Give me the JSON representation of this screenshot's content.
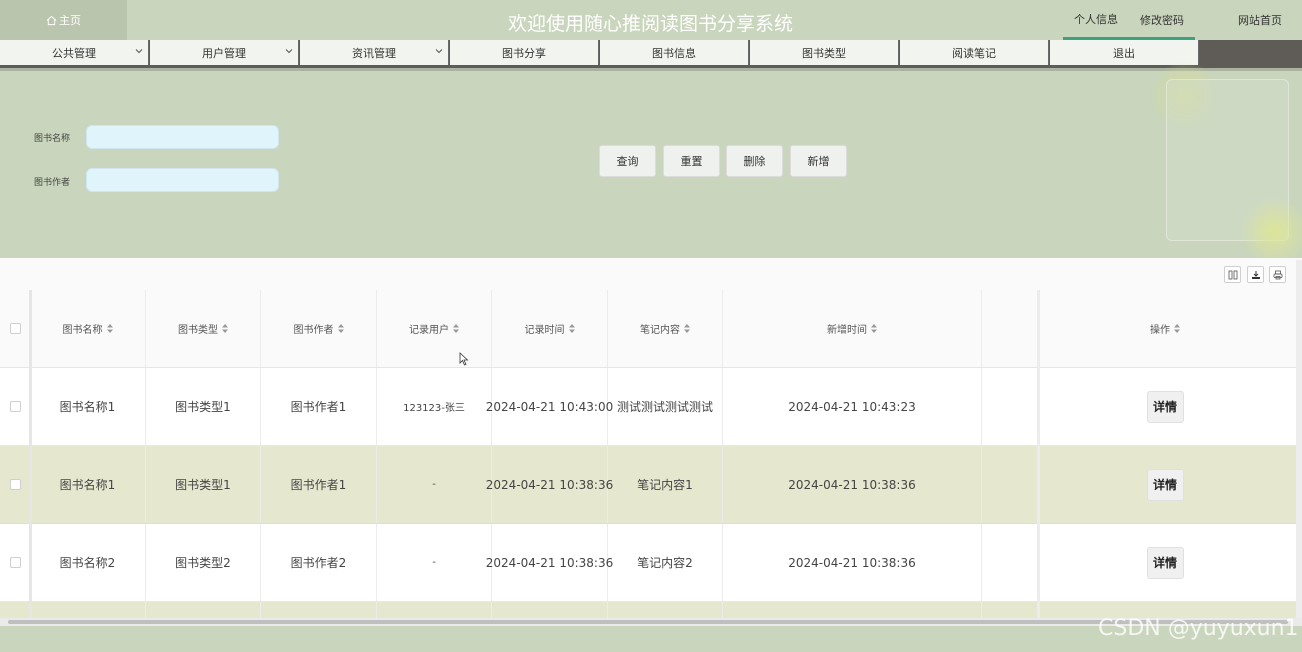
{
  "header": {
    "home": "主页",
    "title": "欢迎使用随心推阅读图书分享系统",
    "links": [
      "个人信息",
      "修改密码",
      "网站首页"
    ]
  },
  "nav": {
    "items": [
      {
        "label": "公共管理",
        "dropdown": true
      },
      {
        "label": "用户管理",
        "dropdown": true
      },
      {
        "label": "资讯管理",
        "dropdown": true
      },
      {
        "label": "图书分享",
        "dropdown": false
      },
      {
        "label": "图书信息",
        "dropdown": false
      },
      {
        "label": "图书类型",
        "dropdown": false
      },
      {
        "label": "阅读笔记",
        "dropdown": false
      },
      {
        "label": "退出",
        "dropdown": false
      }
    ]
  },
  "search": {
    "name_label": "图书名称",
    "name_value": "",
    "author_label": "图书作者",
    "author_value": "",
    "buttons": [
      "查询",
      "重置",
      "删除",
      "新增"
    ]
  },
  "table": {
    "headers": [
      "图书名称",
      "图书类型",
      "图书作者",
      "记录用户",
      "记录时间",
      "笔记内容",
      "新增时间",
      "操作"
    ],
    "rows": [
      [
        "图书名称1",
        "图书类型1",
        "图书作者1",
        "123123-张三",
        "2024-04-21 10:43:00",
        "测试测试测试测试",
        "2024-04-21 10:43:23"
      ],
      [
        "图书名称1",
        "图书类型1",
        "图书作者1",
        "-",
        "2024-04-21 10:38:36",
        "笔记内容1",
        "2024-04-21 10:38:36"
      ],
      [
        "图书名称2",
        "图书类型2",
        "图书作者2",
        "-",
        "2024-04-21 10:38:36",
        "笔记内容2",
        "2024-04-21 10:38:36"
      ]
    ],
    "action_label": "详情"
  },
  "watermark": "CSDN @yuyuxun1",
  "colors": {
    "background": "#c9d5bc",
    "row_alt": "#e6e7cf",
    "accent_underline": "#3fa07e",
    "input_bg": "#e0f4fb"
  }
}
